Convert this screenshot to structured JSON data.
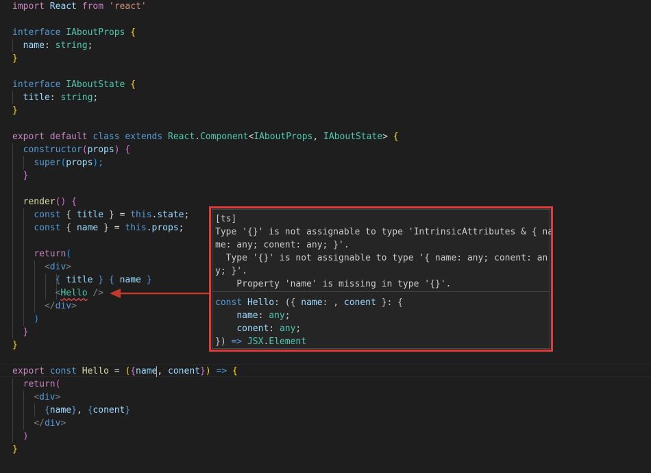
{
  "code": {
    "l1": {
      "kw": "import",
      "name": "React",
      "from": "from",
      "module": "'react'"
    },
    "l3": {
      "kw": "interface",
      "name": "IAboutProps",
      "open": "{"
    },
    "l4": {
      "prop": "name",
      "colon": ":",
      "type": "string",
      "semi": ";"
    },
    "l5": {
      "close": "}"
    },
    "l7": {
      "kw": "interface",
      "name": "IAboutState",
      "open": "{"
    },
    "l8": {
      "prop": "title",
      "colon": ":",
      "type": "string",
      "semi": ";"
    },
    "l9": {
      "close": "}"
    },
    "l11": {
      "export": "export",
      "default": "default",
      "class": "class",
      "extends": "extends",
      "react": "React",
      "dot": ".",
      "component": "Component",
      "lt": "<",
      "p1": "IAboutProps",
      "comma": ",",
      "p2": "IAboutState",
      "gt": ">",
      "open": "{"
    },
    "l12": {
      "name": "constructor",
      "po": "(",
      "param": "props",
      "pc": ")",
      "open": "{"
    },
    "l13": {
      "name": "super",
      "po": "(",
      "param": "props",
      "pc": ");"
    },
    "l14": {
      "close": "}"
    },
    "l16": {
      "name": "render",
      "parens": "()",
      "open": "{"
    },
    "l17": {
      "kw": "const",
      "bo": "{",
      "v": "title",
      "bc": "}",
      "eq": "=",
      "self": "this",
      "dot": ".",
      "prop": "state",
      "semi": ";"
    },
    "l18": {
      "kw": "const",
      "bo": "{",
      "v": "name",
      "bc": "}",
      "eq": "=",
      "self": "this",
      "dot": ".",
      "prop": "props",
      "semi": ";"
    },
    "l20": {
      "kw": "return",
      "po": "("
    },
    "l21": {
      "lt": "<",
      "tag": "div",
      "gt": ">"
    },
    "l22": {
      "b1o": "{",
      "v1": "title",
      "b1c": "}",
      "b2o": "{",
      "v2": "name",
      "b2c": "}"
    },
    "l23": {
      "lt": "<",
      "comp": "Hello",
      "selfclose": "/>"
    },
    "l24": {
      "lt": "</",
      "tag": "div",
      "gt": ">"
    },
    "l25": {
      "pc": ")"
    },
    "l26": {
      "close": "}"
    },
    "l27": {
      "close": "}"
    },
    "l29": {
      "export": "export",
      "kw": "const",
      "name": "Hello",
      "eq": "=",
      "po": "(",
      "bo": "{",
      "p1": "name",
      "comma": ",",
      "p2": "conent",
      "bc": "}",
      "pc": ")",
      "arrow": "=>",
      "open": "{"
    },
    "l30": {
      "kw": "return",
      "po": "("
    },
    "l31": {
      "lt": "<",
      "tag": "div",
      "gt": ">"
    },
    "l32": {
      "b1o": "{",
      "v1": "name",
      "b1c": "}",
      "comma": ",",
      "b2o": "{",
      "v2": "conent",
      "b2c": "}"
    },
    "l33": {
      "lt": "</",
      "tag": "div",
      "gt": ">"
    },
    "l34": {
      "pc": ")"
    },
    "l35": {
      "close": "}"
    }
  },
  "hover": {
    "source": "[ts]",
    "error_l1": "Type '{}' is not assignable to type 'IntrinsicAttributes & { na",
    "error_l2": "me: any; conent: any; }'.",
    "error_l3": "  Type '{}' is not assignable to type '{ name: any; conent: an",
    "error_l4": "y; }'.",
    "error_l5": "    Property 'name' is missing in type '{}'.",
    "sig1": {
      "kw": "const",
      "name": "Hello",
      "rest_a": ": ({ ",
      "p1": "name",
      "rest_b": ": , ",
      "p2": "conent",
      "rest_c": " }: {"
    },
    "sig2": {
      "indent": "    ",
      "prop": "name",
      "colon": ": ",
      "type": "any",
      "semi": ";"
    },
    "sig3": {
      "indent": "    ",
      "prop": "conent",
      "colon": ": ",
      "type": "any",
      "semi": ";"
    },
    "sig4": {
      "pre": "}) ",
      "arrow": "=>",
      "sp": " ",
      "ns": "JSX",
      "dot": ".",
      "type": "Element"
    }
  },
  "colors": {
    "background": "#1e1e1e",
    "hover_border": "#e03b3b",
    "arrow": "#c0392b",
    "error_squiggle": "#f14c4c"
  },
  "icons": {
    "annotation": "arrow-left-icon"
  }
}
